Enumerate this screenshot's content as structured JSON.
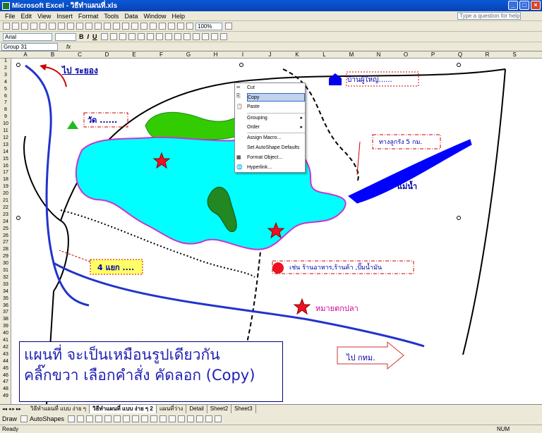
{
  "window": {
    "title": "Microsoft Excel - วิธีทำแผนที่.xls"
  },
  "menubar": {
    "items": [
      "File",
      "Edit",
      "View",
      "Insert",
      "Format",
      "Tools",
      "Data",
      "Window",
      "Help"
    ],
    "help_placeholder": "Type a question for help"
  },
  "toolbar": {
    "zoom": "100%",
    "font_name": "Arial",
    "bold": "B",
    "italic": "I",
    "underline": "U"
  },
  "formula_bar": {
    "name_box": "Group 31",
    "fx": "fx"
  },
  "columns": [
    "A",
    "B",
    "C",
    "D",
    "E",
    "F",
    "G",
    "H",
    "I",
    "J",
    "K",
    "L",
    "M",
    "N",
    "O",
    "P",
    "Q",
    "R",
    "S"
  ],
  "rows": [
    "1",
    "2",
    "3",
    "4",
    "5",
    "6",
    "7",
    "8",
    "9",
    "10",
    "11",
    "12",
    "13",
    "14",
    "15",
    "16",
    "17",
    "18",
    "19",
    "20",
    "21",
    "22",
    "23",
    "24",
    "25",
    "26",
    "27",
    "28",
    "29",
    "30",
    "31",
    "32",
    "33",
    "34",
    "35",
    "36",
    "37",
    "38",
    "39",
    "40",
    "41",
    "42",
    "43",
    "44",
    "45",
    "46",
    "47",
    "48",
    "49"
  ],
  "map_labels": {
    "to_rayong": "ไป ระยอง",
    "temple": "วัด ......",
    "village_head": "บ้านผู้ใหญ่......",
    "curve": "ทางลูกรัง 5 กม.",
    "river": "แม่น้ำ",
    "four_way": "4 แยก ....",
    "shops": "เช่น ร้านอาหาร,ร้านค้า ,ปั๊มน้ำมัน",
    "star_label": "หมายตกปลา",
    "to_bangkok": "ไป กทม."
  },
  "context_menu": {
    "items": [
      "Cut",
      "Copy",
      "Paste",
      "Grouping",
      "Order",
      "Assign Macro...",
      "Set AutoShape Defaults",
      "Format Object...",
      "Hyperlink..."
    ],
    "highlighted": "Copy"
  },
  "callout": {
    "line1": "แผนที่ จะเป็นเหมือนรูปเดียวกัน",
    "line2": "คลิ๊กขวา เลือกคำสั่ง คัดลอก (Copy)"
  },
  "sheet_tabs": [
    "วิธีทำแผนที่ แบบ ง่าย ๆ",
    "วิธีทำแผนที่ แบบ ง่าย ๆ 2",
    "แผนที่ว่าง",
    "Detail",
    "Sheet2",
    "Sheet3"
  ],
  "active_tab": "วิธีทำแผนที่ แบบ ง่าย ๆ 2",
  "drawbar": {
    "draw": "Draw",
    "autoshapes": "AutoShapes"
  },
  "status": {
    "left": "Ready",
    "num": "NUM"
  },
  "colors": {
    "lake": "#00ffff",
    "lake_border": "#cc33cc",
    "river": "#0000ff",
    "road": "#2233cc",
    "forest": "#33cc00",
    "dark_forest": "#228822",
    "star": "#ee1122"
  }
}
